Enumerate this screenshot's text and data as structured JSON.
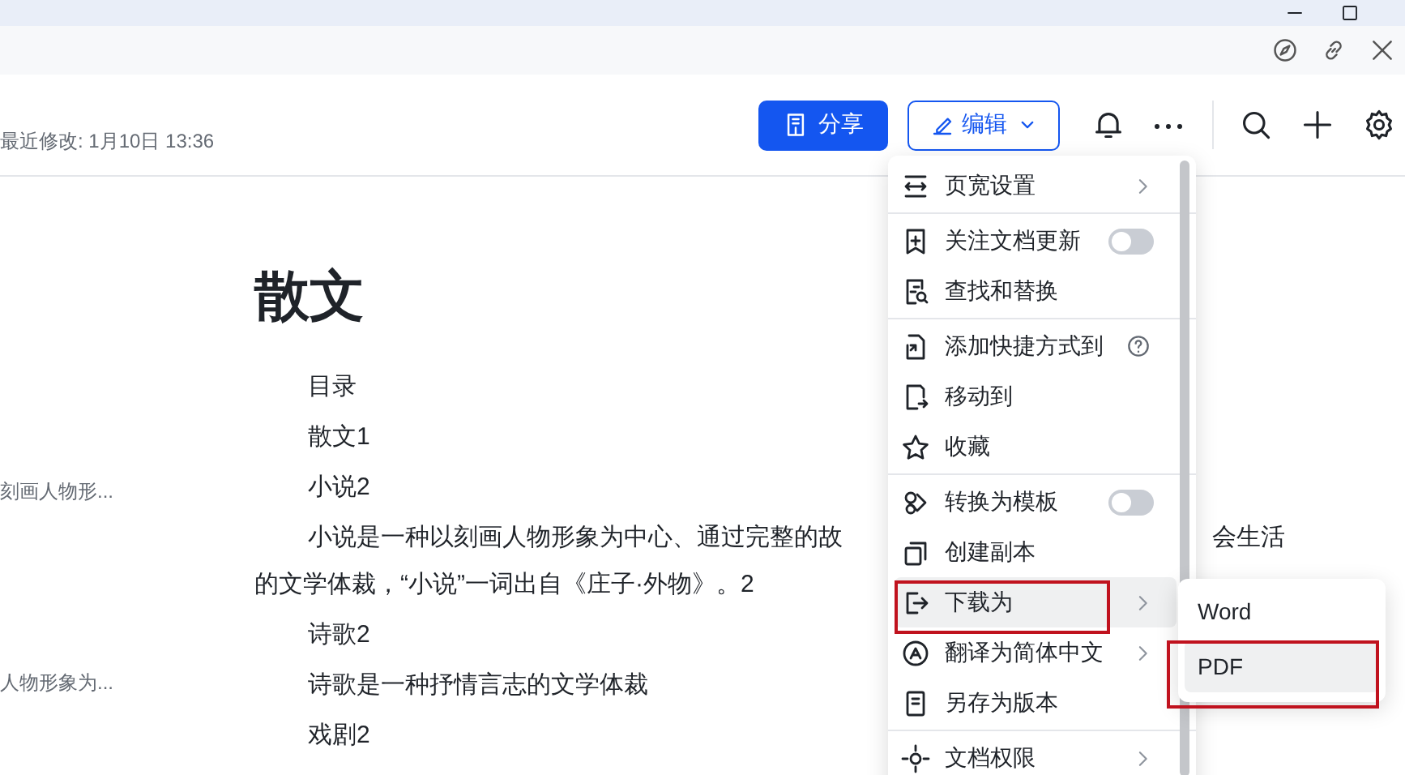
{
  "header": {
    "modified": "最近修改: 1月10日 13:36",
    "share_button": "分享",
    "edit_button": "编辑"
  },
  "outline": [
    "刻画人物形...",
    "人物形象为..."
  ],
  "document": {
    "title": "散文",
    "blocks": [
      {
        "kind": "line",
        "text": "目录"
      },
      {
        "kind": "line",
        "text": "散文1"
      },
      {
        "kind": "line",
        "text": "小说2"
      },
      {
        "kind": "para",
        "text": "小说是一种以刻画人物形象为中心、通过完整的故",
        "tail": "会生活",
        "cont": "的文学体裁，“小说”一词出自《庄子·外物》。2"
      },
      {
        "kind": "line",
        "text": "诗歌2"
      },
      {
        "kind": "line",
        "text": "诗歌是一种抒情言志的文学体裁"
      },
      {
        "kind": "line",
        "text": "戏剧2"
      }
    ]
  },
  "menu": {
    "groups": [
      [
        {
          "kind": "submenu",
          "label": "页宽设置",
          "selected": false
        }
      ],
      [
        {
          "kind": "toggle",
          "label": "关注文档更新",
          "on": false,
          "selected": false
        },
        {
          "kind": "item",
          "label": "查找和替换",
          "selected": false
        }
      ],
      [
        {
          "kind": "help",
          "label": "添加快捷方式到",
          "selected": false
        },
        {
          "kind": "item",
          "label": "移动到",
          "selected": false
        },
        {
          "kind": "item",
          "label": "收藏",
          "selected": false
        }
      ],
      [
        {
          "kind": "toggle",
          "label": "转换为模板",
          "on": false,
          "selected": false
        },
        {
          "kind": "item",
          "label": "创建副本",
          "selected": false
        },
        {
          "kind": "submenu",
          "label": "下载为",
          "selected": true
        },
        {
          "kind": "submenu",
          "label": "翻译为简体中文",
          "selected": false
        },
        {
          "kind": "item",
          "label": "另存为版本",
          "selected": false
        }
      ],
      [
        {
          "kind": "submenu",
          "label": "文档权限",
          "selected": false
        }
      ]
    ]
  },
  "submenu": [
    {
      "label": "Word",
      "selected": false
    },
    {
      "label": "PDF",
      "selected": true
    }
  ]
}
